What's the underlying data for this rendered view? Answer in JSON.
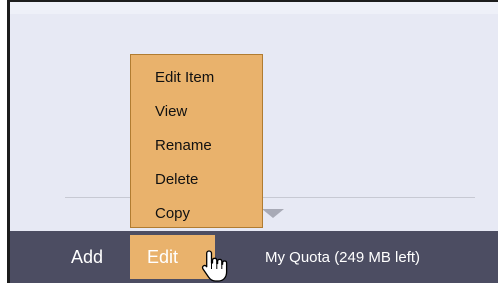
{
  "toolbar": {
    "add_label": "Add",
    "edit_label": "Edit",
    "quota_label": "My Quota (249 MB left)"
  },
  "edit_menu": {
    "items": [
      {
        "label": "Edit Item"
      },
      {
        "label": "View"
      },
      {
        "label": "Rename"
      },
      {
        "label": "Delete"
      },
      {
        "label": "Copy"
      }
    ]
  },
  "colors": {
    "toolbar_bg": "#4c4d62",
    "menu_bg": "#e9b26c",
    "menu_border": "#b17c31",
    "panel_bg": "#e7e9f4"
  },
  "icons": {
    "pointer": "hand-pointer-icon",
    "divider": "collapse-arrow-icon"
  }
}
